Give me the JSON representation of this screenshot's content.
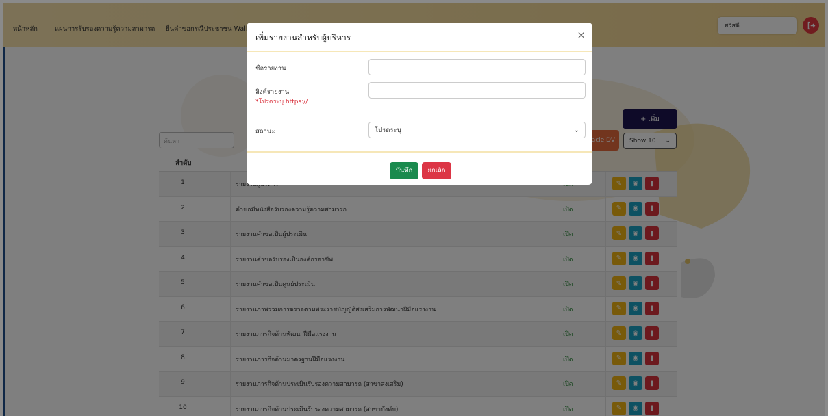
{
  "nav": {
    "links": [
      "หน้าหลัก",
      "แผนการรับรองความรู้ความสามารถ",
      "ยื่นคำขอกรณีประชาชน Walk"
    ],
    "greeting": "สวัสดี",
    "logout_icon": "logout-icon"
  },
  "page": {
    "search_placeholder": "ค้นหา",
    "add_button": "เพิ่ม",
    "oracle_button": "racle DV",
    "show_select": "Show 10",
    "table_header_num": "ลำดับ",
    "rows": [
      {
        "num": "1",
        "name": "รายงานผู้บริหาร",
        "status": "เปิด"
      },
      {
        "num": "2",
        "name": "คำขอมีหนังสือรับรองความรู้ความสามารถ",
        "status": "เปิด"
      },
      {
        "num": "3",
        "name": "รายงานคำขอเป็นผู้ประเมิน",
        "status": "เปิด"
      },
      {
        "num": "4",
        "name": "รายงานคำขอรับรองเป็นองค์กรอาชีพ",
        "status": "เปิด"
      },
      {
        "num": "5",
        "name": "รายงานคำขอเป็นศูนย์ประเมิน",
        "status": "เปิด"
      },
      {
        "num": "6",
        "name": "รายงานภาพรวมการตรวจตามพระราชบัญญัติส่งเสริมการพัฒนาฝีมือแรงงาน",
        "status": "เปิด"
      },
      {
        "num": "7",
        "name": "รายงานภารกิจด้านพัฒนาฝีมือแรงงาน",
        "status": "เปิด"
      },
      {
        "num": "8",
        "name": "รายงานภารกิจด้านมาตรฐานฝีมือแรงงาน",
        "status": "เปิด"
      },
      {
        "num": "9",
        "name": "รายงานภารกิจด้านประเมินรับรองความสามารถ (สาขาส่งเสริม)",
        "status": "เปิด"
      },
      {
        "num": "10",
        "name": "รายงานภารกิจด้านประเมินรับรองความสามารถ (สาขาบังคับ)",
        "status": "เปิด"
      }
    ]
  },
  "modal": {
    "title": "เพิ่มรายงานสำหรับผู้บริหาร",
    "close": "×",
    "report_name_label": "ชื่อรายงาน",
    "report_name_value": "",
    "report_link_label": "ลิงค์รายงาน",
    "report_link_hint": "*โปรดระบุ https://",
    "report_link_value": "",
    "status_label": "สถานะ",
    "status_value": "โปรดระบุ",
    "save_button": "บันทึก",
    "cancel_button": "ยกเลิก"
  },
  "colors": {
    "navbar": "#f6dea0",
    "add_button": "#1c1550",
    "save": "#1a8a4e",
    "cancel": "#dc3545",
    "edit": "#f0b414",
    "view": "#1aa3c4",
    "delete": "#d9323d"
  }
}
